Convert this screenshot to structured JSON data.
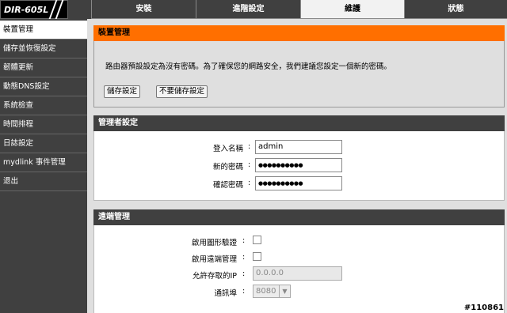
{
  "header": {
    "model": "DIR-605L",
    "tabs": [
      "安裝",
      "進階設定",
      "維護",
      "狀態"
    ],
    "active_tab": 2
  },
  "sidebar": {
    "items": [
      {
        "label": "裝置管理",
        "active": true
      },
      {
        "label": "儲存並恢復設定"
      },
      {
        "label": "韌體更新"
      },
      {
        "label": "動態DNS設定"
      },
      {
        "label": "系統檢查"
      },
      {
        "label": "時間排程"
      },
      {
        "label": "日誌設定"
      },
      {
        "label": "mydlink 事件管理"
      },
      {
        "label": "退出"
      }
    ]
  },
  "device_mgmt": {
    "title": "裝置管理",
    "message": "路由器預設設定為沒有密碼。為了確保您的網路安全，我們建議您設定一個新的密碼。",
    "save_label": "儲存設定",
    "dont_save_label": "不要儲存設定"
  },
  "admin": {
    "title": "管理者設定",
    "login_label": "登入名稱",
    "login_value": "admin",
    "new_pw_label": "新的密碼",
    "new_pw_value": "●●●●●●●●●●",
    "confirm_pw_label": "確認密碼",
    "confirm_pw_value": "●●●●●●●●●●"
  },
  "remote": {
    "title": "遠端管理",
    "captcha_label": "啟用圖形驗證",
    "remote_label": "啟用遠端管理",
    "ip_label": "允許存取的IP",
    "ip_value": "0.0.0.0",
    "port_label": "通訊埠",
    "port_value": "8080"
  },
  "watermark": "#110861",
  "colors": {
    "accent": "#ff6f00",
    "dark": "#404040"
  }
}
